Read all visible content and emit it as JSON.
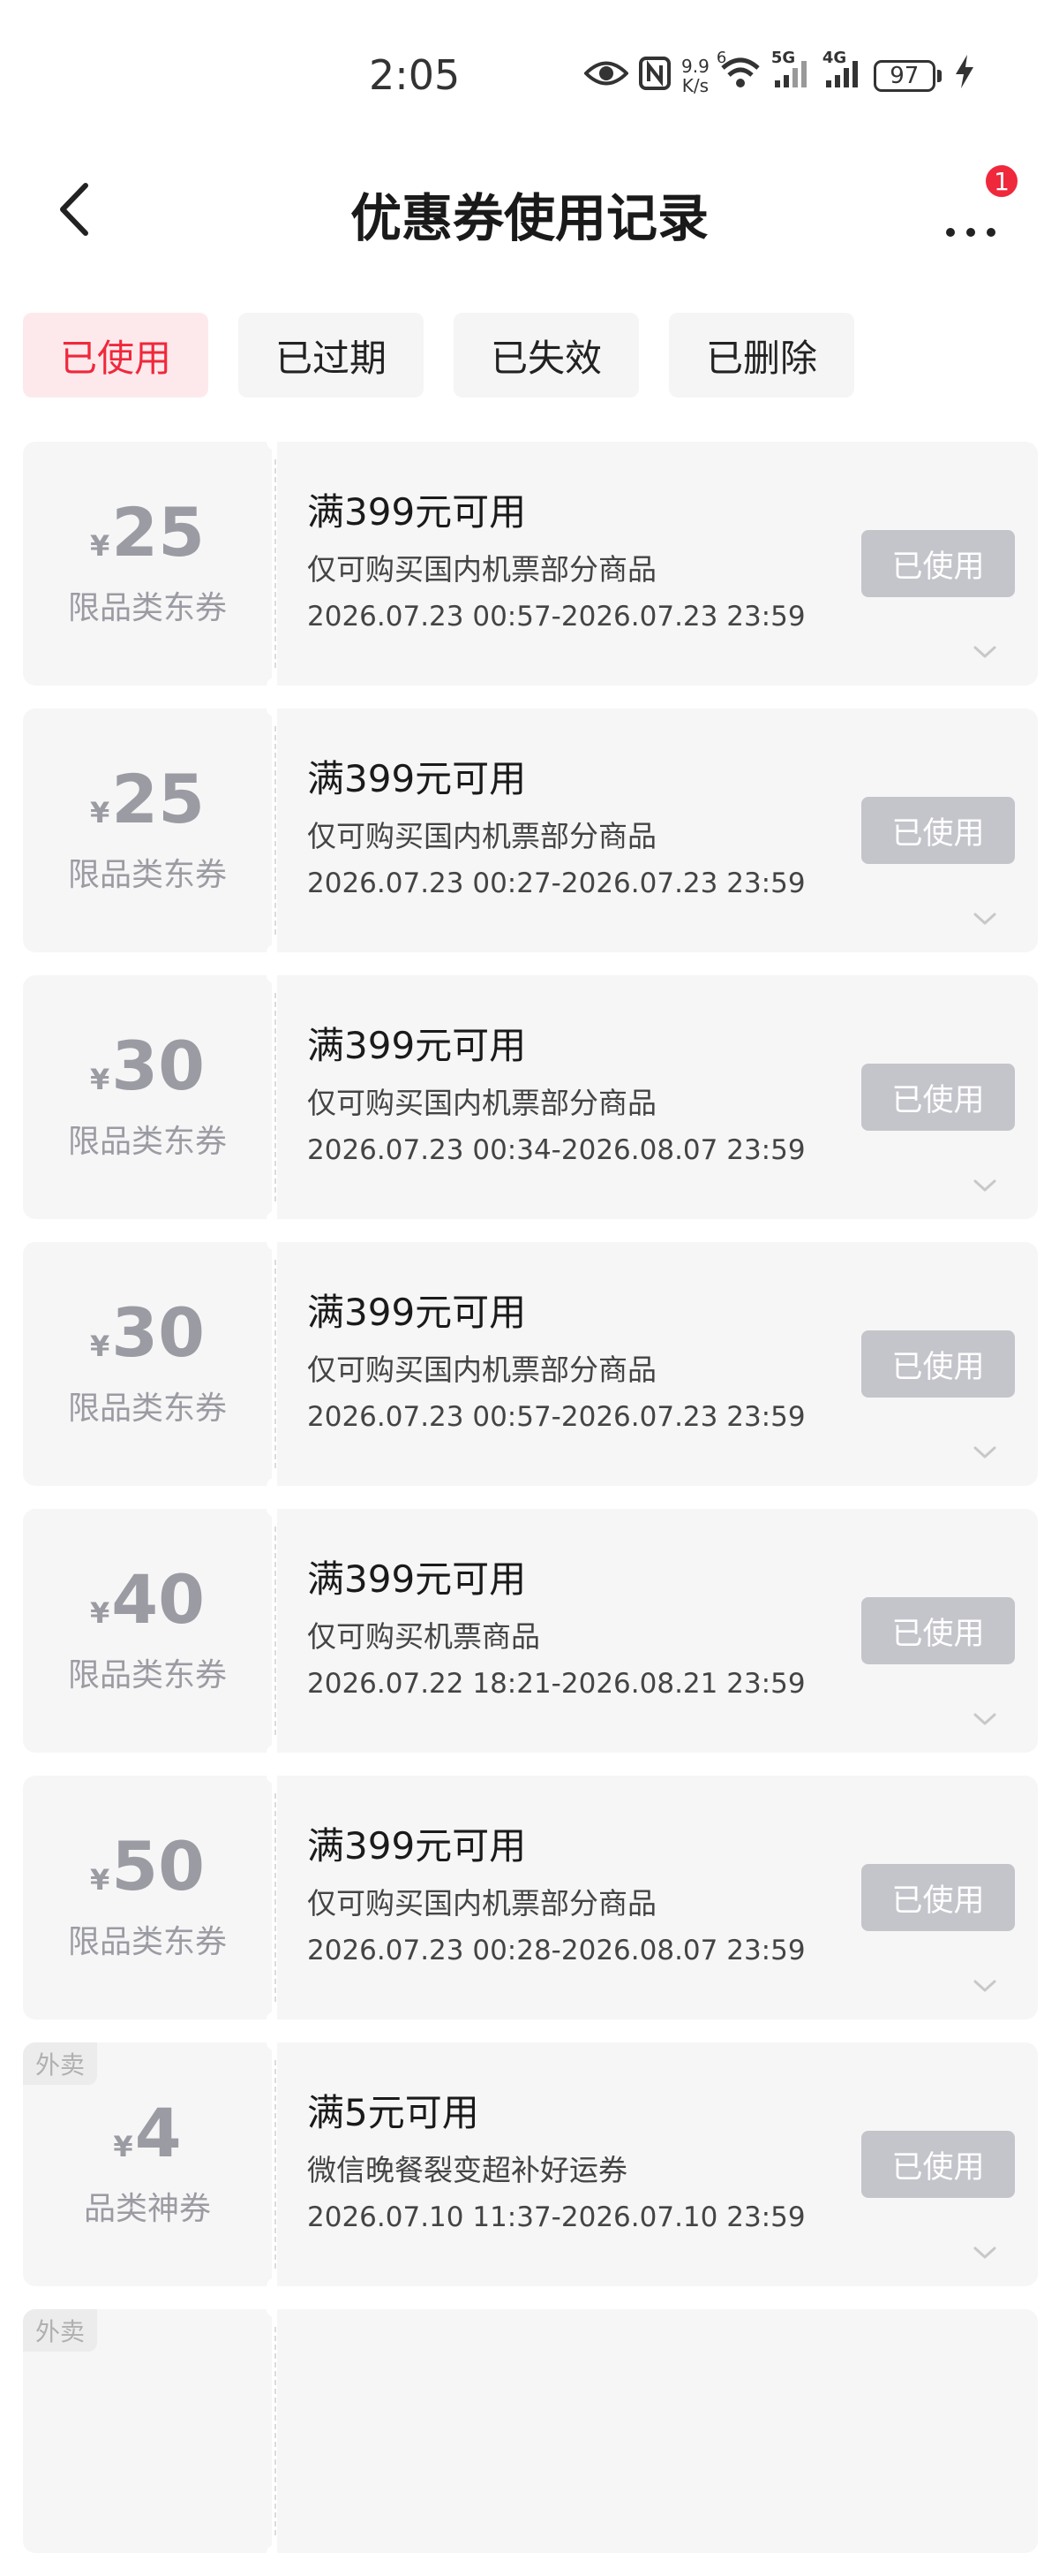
{
  "status_bar": {
    "time": "2:05",
    "net_speed_value": "9.9",
    "net_speed_unit": "K/s",
    "wifi_label": "6",
    "signal1_label": "5G",
    "signal2_label": "4G",
    "battery": "97"
  },
  "header": {
    "title": "优惠券使用记录",
    "notification_count": "1"
  },
  "tabs": [
    {
      "label": "已使用",
      "active": true
    },
    {
      "label": "已过期",
      "active": false
    },
    {
      "label": "已失效",
      "active": false
    },
    {
      "label": "已删除",
      "active": false
    }
  ],
  "coupons": [
    {
      "currency": "¥",
      "amount": "25",
      "type": "限品类东券",
      "tag": "",
      "condition": "满399元可用",
      "desc": "仅可购买国内机票部分商品",
      "date": "2026.07.23 00:57-2026.07.23 23:59",
      "status": "已使用"
    },
    {
      "currency": "¥",
      "amount": "25",
      "type": "限品类东券",
      "tag": "",
      "condition": "满399元可用",
      "desc": "仅可购买国内机票部分商品",
      "date": "2026.07.23 00:27-2026.07.23 23:59",
      "status": "已使用"
    },
    {
      "currency": "¥",
      "amount": "30",
      "type": "限品类东券",
      "tag": "",
      "condition": "满399元可用",
      "desc": "仅可购买国内机票部分商品",
      "date": "2026.07.23 00:34-2026.08.07 23:59",
      "status": "已使用"
    },
    {
      "currency": "¥",
      "amount": "30",
      "type": "限品类东券",
      "tag": "",
      "condition": "满399元可用",
      "desc": "仅可购买国内机票部分商品",
      "date": "2026.07.23 00:57-2026.07.23 23:59",
      "status": "已使用"
    },
    {
      "currency": "¥",
      "amount": "40",
      "type": "限品类东券",
      "tag": "",
      "condition": "满399元可用",
      "desc": "仅可购买机票商品",
      "date": "2026.07.22 18:21-2026.08.21 23:59",
      "status": "已使用"
    },
    {
      "currency": "¥",
      "amount": "50",
      "type": "限品类东券",
      "tag": "",
      "condition": "满399元可用",
      "desc": "仅可购买国内机票部分商品",
      "date": "2026.07.23 00:28-2026.08.07 23:59",
      "status": "已使用"
    },
    {
      "currency": "¥",
      "amount": "4",
      "type": "品类神券",
      "tag": "外卖",
      "condition": "满5元可用",
      "desc": "微信晚餐裂变超补好运券",
      "date": "2026.07.10 11:37-2026.07.10 23:59",
      "status": "已使用"
    },
    {
      "currency": "",
      "amount": "",
      "type": "",
      "tag": "外卖",
      "condition": "",
      "desc": "",
      "date": "",
      "status": ""
    }
  ]
}
